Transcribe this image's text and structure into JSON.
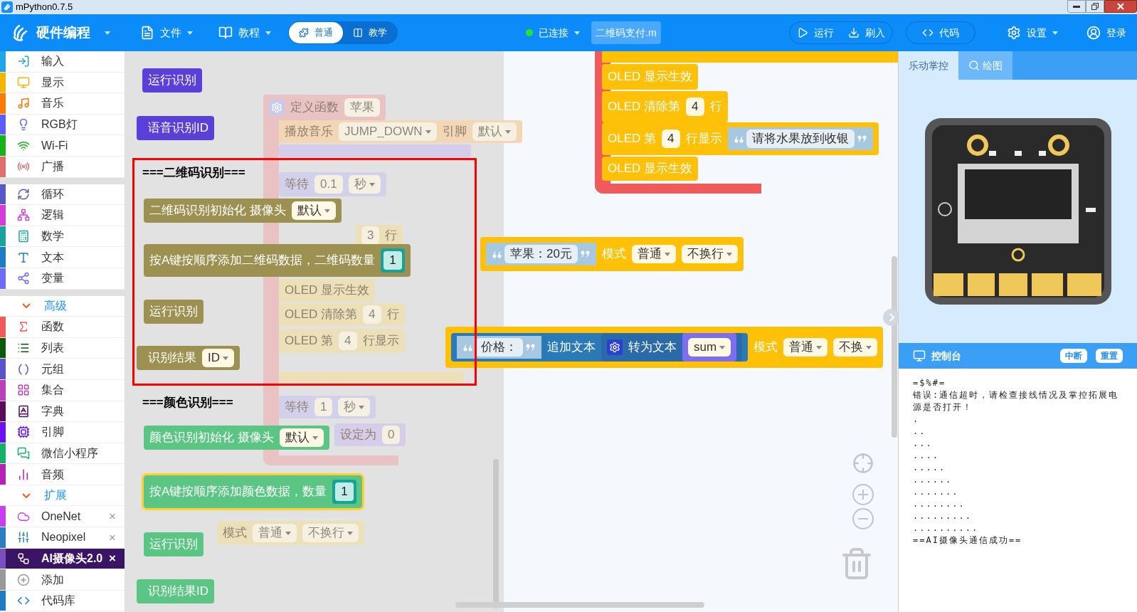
{
  "title_bar": {
    "title": "mPython0.7.5"
  },
  "top_bar": {
    "brand": "硬件编程",
    "menus": [
      {
        "label": "文件"
      },
      {
        "label": "教程"
      }
    ],
    "mode_toggle": [
      {
        "label": "普通",
        "selected": true
      },
      {
        "label": "教学",
        "selected": false
      }
    ],
    "connection": {
      "label": "已连接",
      "connected": true
    },
    "file_tab": "二维码支付.m",
    "actions": [
      {
        "label": "运行"
      },
      {
        "label": "刷入"
      }
    ],
    "code_button": "代码",
    "settings": "设置",
    "login": "登录"
  },
  "sidebar": {
    "sections": [
      {
        "items": [
          {
            "kind": "category",
            "label": "输入",
            "color": "#1ea7e8",
            "selected": false
          },
          {
            "kind": "category",
            "label": "显示",
            "color": "#f5b400",
            "selected": false
          },
          {
            "kind": "category",
            "label": "音乐",
            "color": "#fb7a00",
            "selected": false
          },
          {
            "kind": "category",
            "label": "RGB灯",
            "color": "#5c5cff",
            "selected": false
          },
          {
            "kind": "category",
            "label": "Wi-Fi",
            "color": "#17b217",
            "selected": false
          },
          {
            "kind": "category",
            "label": "广播",
            "color": "#e07070",
            "selected": false
          }
        ]
      },
      {
        "items": [
          {
            "kind": "category",
            "label": "循环",
            "color": "#5a58c5",
            "selected": false
          },
          {
            "kind": "category",
            "label": "逻辑",
            "color": "#d33cd8",
            "selected": false
          },
          {
            "kind": "category",
            "label": "数学",
            "color": "#19a29e",
            "selected": false
          },
          {
            "kind": "category",
            "label": "文本",
            "color": "#1e7dc2",
            "selected": false
          },
          {
            "kind": "category",
            "label": "变量",
            "color": "#6f6af8",
            "selected": false
          }
        ]
      },
      {
        "items": [
          {
            "kind": "header",
            "label": "高级",
            "expanded": true
          },
          {
            "kind": "category",
            "label": "函数",
            "color": "#ef5b5b",
            "selected": false
          },
          {
            "kind": "category",
            "label": "列表",
            "color": "#0b5a0b",
            "selected": false
          },
          {
            "kind": "category",
            "label": "元组",
            "color": "#5b52c8",
            "selected": false
          },
          {
            "kind": "category",
            "label": "集合",
            "color": "#bb3fbc",
            "selected": false
          },
          {
            "kind": "category",
            "label": "字典",
            "color": "#5a0b5a",
            "selected": false
          },
          {
            "kind": "category",
            "label": "引脚",
            "color": "#6a13f0",
            "selected": false
          },
          {
            "kind": "category",
            "label": "微信小程序",
            "color": "#17b06a",
            "selected": false
          },
          {
            "kind": "category",
            "label": "音频",
            "color": "#b621b6",
            "selected": false
          },
          {
            "kind": "header",
            "label": "扩展",
            "expanded": true
          },
          {
            "kind": "category",
            "label": "OneNet",
            "color": "#c93ef0",
            "selected": false,
            "close": "×"
          },
          {
            "kind": "category",
            "label": "Neopixel",
            "color": "#2b7fc0",
            "selected": false,
            "close": "×"
          },
          {
            "kind": "category",
            "label": "AI摄像头2.0",
            "color": "#7a4fc0",
            "selected": true,
            "close": "×"
          },
          {
            "kind": "category",
            "label": "添加",
            "color": "#999999",
            "selected": false
          },
          {
            "kind": "category",
            "label": "代码库",
            "color": "#1e7dc2",
            "selected": false
          }
        ]
      }
    ]
  },
  "flyout": {
    "items": [
      {
        "kind": "block",
        "color": "#5b3fd9",
        "selected": false,
        "parts": [
          {
            "kind": "label",
            "text": "运行识别"
          }
        ]
      },
      {
        "kind": "block",
        "color": "#5b3fd9",
        "selected": false,
        "parts": [
          {
            "kind": "label",
            "text": "语音识别ID"
          }
        ]
      },
      {
        "kind": "heading",
        "text": "===二维码识别==="
      },
      {
        "kind": "block",
        "color": "#9c9150",
        "selected": false,
        "parts": [
          {
            "kind": "label",
            "text": "二维码识别初始化 摄像头"
          },
          {
            "kind": "dropdown",
            "text": "默认"
          }
        ]
      },
      {
        "kind": "block",
        "color": "#9c9150",
        "selected": false,
        "parts": [
          {
            "kind": "label",
            "text": "按A键按顺序添加二维码数据，二维码数量"
          },
          {
            "kind": "number",
            "text": "1"
          }
        ]
      },
      {
        "kind": "block",
        "color": "#9c9150",
        "selected": false,
        "parts": [
          {
            "kind": "label",
            "text": "运行识别"
          }
        ]
      },
      {
        "kind": "block",
        "color": "#9c9150",
        "selected": false,
        "parts": [
          {
            "kind": "label",
            "text": "识别结果"
          },
          {
            "kind": "dropdown",
            "text": "ID"
          }
        ]
      },
      {
        "kind": "heading",
        "text": "===颜色识别==="
      },
      {
        "kind": "block",
        "color": "#5bc583",
        "selected": false,
        "parts": [
          {
            "kind": "label",
            "text": "颜色识别初始化 摄像头"
          },
          {
            "kind": "dropdown",
            "text": "默认"
          }
        ]
      },
      {
        "kind": "block",
        "color": "#5bc583",
        "selected": true,
        "parts": [
          {
            "kind": "label",
            "text": "按A键按顺序添加颜色数据，数量"
          },
          {
            "kind": "number",
            "text": "1"
          }
        ]
      },
      {
        "kind": "block",
        "color": "#5bc583",
        "selected": false,
        "parts": [
          {
            "kind": "label",
            "text": "运行识别"
          }
        ]
      },
      {
        "kind": "block",
        "color": "#5bc583",
        "selected": false,
        "parts": [
          {
            "kind": "label",
            "text": "识别结果ID"
          }
        ]
      }
    ]
  },
  "workspace": {
    "blocks": [
      {
        "color": "#e9c3c4",
        "parts": [
          {
            "kind": "gear"
          },
          {
            "kind": "label",
            "text": "定义函数"
          },
          {
            "kind": "field",
            "text": "苹果"
          }
        ]
      },
      {
        "color": "#f3d6b4",
        "parts": [
          {
            "kind": "label",
            "text": "播放音乐"
          },
          {
            "kind": "dropdown",
            "text": "JUMP_DOWN"
          },
          {
            "kind": "label",
            "text": "引脚"
          },
          {
            "kind": "dropdown",
            "text": "默认"
          }
        ]
      },
      {
        "color": "#d2d0ea",
        "parts": [
          {
            "kind": "label",
            "text": "等待"
          },
          {
            "kind": "field",
            "text": "0.1"
          },
          {
            "kind": "dropdown",
            "text": "秒"
          }
        ]
      },
      {
        "color": "#ece0b8",
        "parts": [
          {
            "kind": "field",
            "text": "3"
          },
          {
            "kind": "label",
            "text": "行"
          }
        ]
      },
      {
        "color": "#ffc107",
        "parts": [
          {
            "kind": "string",
            "text": "苹果：20元"
          },
          {
            "kind": "label",
            "text": "模式"
          },
          {
            "kind": "dropdown",
            "text": "普通"
          },
          {
            "kind": "dropdown",
            "text": "不换行"
          }
        ]
      },
      {
        "color": "#ece0b8",
        "parts": [
          {
            "kind": "label",
            "text": "OLED 显示生效"
          }
        ]
      },
      {
        "color": "#ece0b8",
        "parts": [
          {
            "kind": "label",
            "text": "OLED 清除第"
          },
          {
            "kind": "field",
            "text": "4"
          },
          {
            "kind": "label",
            "text": "行"
          }
        ]
      },
      {
        "color": "#ece0b8",
        "parts": [
          {
            "kind": "label",
            "text": "OLED 第"
          },
          {
            "kind": "field",
            "text": "4"
          },
          {
            "kind": "label",
            "text": "行显示"
          }
        ]
      },
      {
        "color": "#ffc107",
        "parts": [
          {
            "kind": "nested",
            "color": "#2a7ab8",
            "parts": [
              {
                "kind": "string",
                "text": "价格："
              },
              {
                "kind": "label",
                "text": "追加文本"
              },
              {
                "kind": "nested",
                "color": "#2a6aa8",
                "parts": [
                  {
                    "kind": "gear"
                  },
                  {
                    "kind": "label",
                    "text": "转为文本"
                  },
                  {
                    "kind": "nested",
                    "color": "#7b6ff0",
                    "parts": [
                      {
                        "kind": "dropdown",
                        "text": "sum"
                      }
                    ]
                  }
                ]
              }
            ]
          },
          {
            "kind": "label",
            "text": "模式"
          },
          {
            "kind": "dropdown",
            "text": "普通"
          },
          {
            "kind": "dropdown",
            "text": "不换"
          }
        ]
      },
      {
        "color": "#d2d0ea",
        "parts": [
          {
            "kind": "label",
            "text": "等待"
          },
          {
            "kind": "field",
            "text": "1"
          },
          {
            "kind": "dropdown",
            "text": "秒"
          }
        ]
      },
      {
        "color": "#d6cdea",
        "parts": [
          {
            "kind": "label",
            "text": "设定为"
          },
          {
            "kind": "field",
            "text": "0"
          }
        ]
      },
      {
        "color": "#ece0b8",
        "parts": [
          {
            "kind": "label",
            "text": "模式"
          },
          {
            "kind": "dropdown",
            "text": "普通"
          },
          {
            "kind": "dropdown",
            "text": "不换行"
          }
        ]
      },
      {
        "color": "#ffc107",
        "parts": [
          {
            "kind": "label",
            "text": "OLED 显示生效"
          }
        ]
      },
      {
        "color": "#ffc107",
        "parts": [
          {
            "kind": "label",
            "text": "OLED 清除第"
          },
          {
            "kind": "field",
            "text": "4"
          },
          {
            "kind": "label",
            "text": "行"
          }
        ]
      },
      {
        "color": "#ffc107",
        "parts": [
          {
            "kind": "label",
            "text": "OLED 第"
          },
          {
            "kind": "field",
            "text": "4"
          },
          {
            "kind": "label",
            "text": "行显示"
          },
          {
            "kind": "string",
            "text": "请将水果放到收银"
          }
        ]
      },
      {
        "color": "#ffc107",
        "parts": [
          {
            "kind": "label",
            "text": "OLED 显示生效"
          }
        ]
      }
    ]
  },
  "right_panel": {
    "tabs": [
      {
        "label": "乐动掌控",
        "selected": true
      },
      {
        "label": "绘图",
        "selected": false
      }
    ],
    "console": {
      "title": "控制台",
      "buttons": [
        "中断",
        "重置"
      ],
      "lines": [
        "=$%#=",
        "错误:通信超时，请检查接线情况及掌控拓展电源是否打开！",
        ".",
        "..",
        "...",
        "....",
        ".....",
        "......",
        ".......",
        "........",
        ".........",
        "..........",
        "==AI摄像头通信成功=="
      ]
    }
  }
}
